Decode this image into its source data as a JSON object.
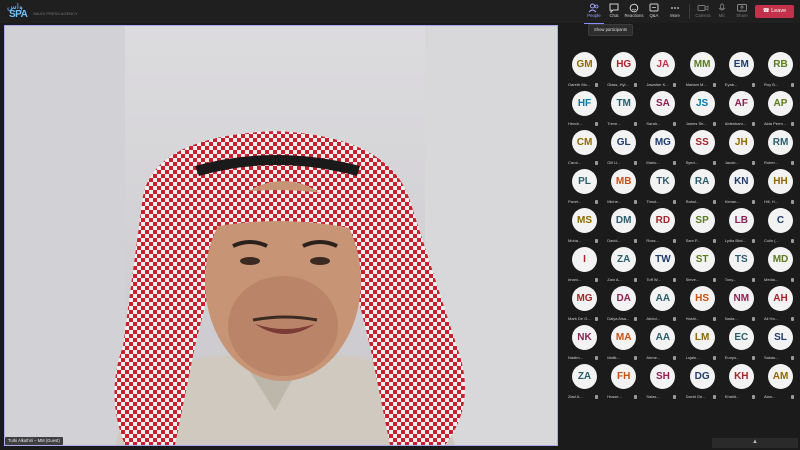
{
  "logo": {
    "arabic": "واس",
    "english": "SPA",
    "tagline": "SAUDI PRESS AGENCY"
  },
  "toolbar": {
    "people": "People",
    "chat": "Chat",
    "reactions": "Reactions",
    "qa": "Q&A",
    "more": "More",
    "camera": "Camera",
    "mic": "Mic",
    "share": "Share",
    "leave": "Leave"
  },
  "tooltip": "Show participants",
  "speaker_name": "Turki Alkathiri – MM (Guest)",
  "colors": {
    "accent": "#8a8fff",
    "leave": "#c4314b"
  },
  "participants": [
    {
      "initials": "GM",
      "name": "Gareth Mo...",
      "color": "#8f6a00"
    },
    {
      "initials": "HG",
      "name": "Glass, Hyl...",
      "color": "#a4262c"
    },
    {
      "initials": "JA",
      "name": "Jawaher K...",
      "color": "#c4314b"
    },
    {
      "initials": "MM",
      "name": "Mariam M...",
      "color": "#5c7b1f"
    },
    {
      "initials": "EM",
      "name": "Eyab...",
      "color": "#1e3c6e"
    },
    {
      "initials": "RB",
      "name": "Roy B...",
      "color": "#5c7b1f"
    },
    {
      "initials": "HF",
      "name": "Hendr...",
      "color": "#0078a8"
    },
    {
      "initials": "TM",
      "name": "Treve...",
      "color": "#2b5d6d"
    },
    {
      "initials": "SA",
      "name": "Sarah...",
      "color": "#8b2252"
    },
    {
      "initials": "JS",
      "name": "James Sh...",
      "color": "#0078a8"
    },
    {
      "initials": "AF",
      "name": "Abtesham...",
      "color": "#8b2252"
    },
    {
      "initials": "AP",
      "name": "Alda Perm...",
      "color": "#5c7b1f"
    },
    {
      "initials": "CM",
      "name": "Carol...",
      "color": "#8f6a00"
    },
    {
      "initials": "GL",
      "name": "Gill Li...",
      "color": "#1e3c6e"
    },
    {
      "initials": "MG",
      "name": "Mario...",
      "color": "#1e3c6e"
    },
    {
      "initials": "SS",
      "name": "Syed...",
      "color": "#a4262c"
    },
    {
      "initials": "JH",
      "name": "Jacob...",
      "color": "#8f6a00"
    },
    {
      "initials": "RM",
      "name": "Rober...",
      "color": "#2b5d6d"
    },
    {
      "initials": "PL",
      "name": "Pavel...",
      "color": "#2b5d6d"
    },
    {
      "initials": "MB",
      "name": "Miche...",
      "color": "#ca5010"
    },
    {
      "initials": "TK",
      "name": "Timot...",
      "color": "#2b5d6d"
    },
    {
      "initials": "RA",
      "name": "Rahul...",
      "color": "#2b5d6d"
    },
    {
      "initials": "KN",
      "name": "Kieran...",
      "color": "#1e3c6e"
    },
    {
      "initials": "HH",
      "name": "Hill, H...",
      "color": "#8f6a00"
    },
    {
      "initials": "MS",
      "name": "Moha...",
      "color": "#8f6a00"
    },
    {
      "initials": "DM",
      "name": "David...",
      "color": "#2b5d6d"
    },
    {
      "initials": "RD",
      "name": "Ross...",
      "color": "#a4262c"
    },
    {
      "initials": "SP",
      "name": "Sam P...",
      "color": "#5c7b1f"
    },
    {
      "initials": "LB",
      "name": "Lydia Bird...",
      "color": "#8b2252"
    },
    {
      "initials": "C",
      "name": "Colin (...",
      "color": "#1e3c6e"
    },
    {
      "initials": "I",
      "name": "Imani...",
      "color": "#a4262c"
    },
    {
      "initials": "ZA",
      "name": "Zain A...",
      "color": "#2b5d6d"
    },
    {
      "initials": "TW",
      "name": "Toff W...",
      "color": "#1e3c6e"
    },
    {
      "initials": "ST",
      "name": "Steve...",
      "color": "#5c7b1f"
    },
    {
      "initials": "TS",
      "name": "Tony...",
      "color": "#2b5d6d"
    },
    {
      "initials": "MD",
      "name": "Media...",
      "color": "#5c7b1f"
    },
    {
      "initials": "MG",
      "name": "Mark De G...",
      "color": "#a4262c"
    },
    {
      "initials": "DA",
      "name": "Dalya Alsa...",
      "color": "#8b2252"
    },
    {
      "initials": "AA",
      "name": "Abdul...",
      "color": "#2b5d6d"
    },
    {
      "initials": "HS",
      "name": "Hashi...",
      "color": "#ca5010"
    },
    {
      "initials": "NM",
      "name": "Nada...",
      "color": "#8b2252"
    },
    {
      "initials": "AH",
      "name": "Ali Ha...",
      "color": "#a4262c"
    },
    {
      "initials": "NK",
      "name": "Nadim...",
      "color": "#8b2252"
    },
    {
      "initials": "MA",
      "name": "Malik...",
      "color": "#ca5010"
    },
    {
      "initials": "AA",
      "name": "Ahme...",
      "color": "#2b5d6d"
    },
    {
      "initials": "LM",
      "name": "Lujain...",
      "color": "#8f6a00"
    },
    {
      "initials": "EC",
      "name": "Eunyo...",
      "color": "#2b5d6d"
    },
    {
      "initials": "SL",
      "name": "Sakas...",
      "color": "#1e3c6e"
    },
    {
      "initials": "ZA",
      "name": "Ziad A...",
      "color": "#2b5d6d"
    },
    {
      "initials": "FH",
      "name": "Husse...",
      "color": "#ca5010"
    },
    {
      "initials": "SH",
      "name": "Salas...",
      "color": "#8b2252"
    },
    {
      "initials": "DG",
      "name": "David Ge...",
      "color": "#1e3c6e"
    },
    {
      "initials": "KH",
      "name": "Khalid...",
      "color": "#a4262c"
    },
    {
      "initials": "AM",
      "name": "Alan...",
      "color": "#8f6a00"
    }
  ]
}
